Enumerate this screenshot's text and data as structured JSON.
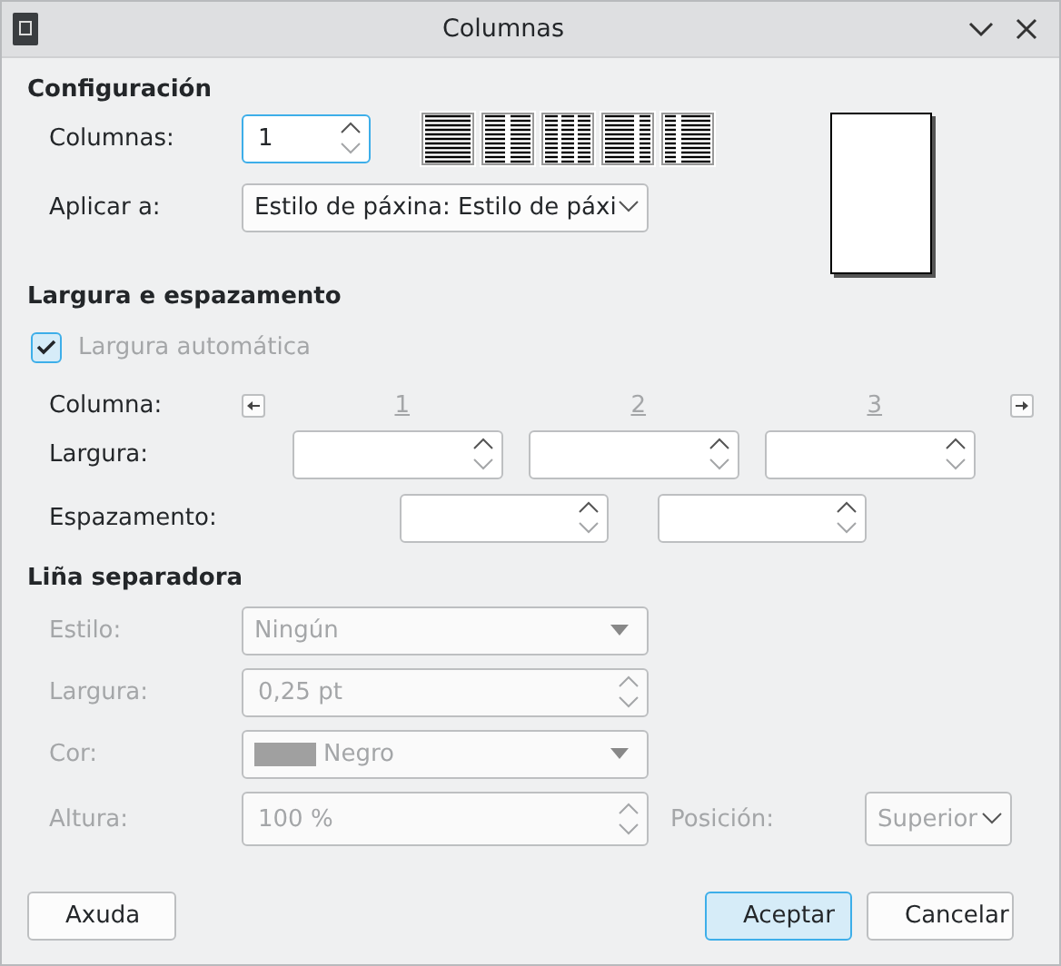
{
  "window": {
    "title": "Columnas"
  },
  "settings": {
    "heading": "Configuración",
    "columns_label": "Columnas:",
    "columns_value": "1",
    "columns_focused": true,
    "presets": [
      {
        "kind": "one",
        "selected": false
      },
      {
        "kind": "two",
        "selected": false
      },
      {
        "kind": "three",
        "selected": false
      },
      {
        "kind": "left",
        "selected": false
      },
      {
        "kind": "right",
        "selected": false
      }
    ],
    "apply_label": "Aplicar a:",
    "apply_value": "Estilo de páxina: Estilo de páxi"
  },
  "width_spacing": {
    "heading": "Largura e espazamento",
    "auto_width": {
      "label": "Largura automática",
      "checked": true,
      "disabled": true
    },
    "column_label": "Columna:",
    "column_numbers": [
      "1",
      "2",
      "3"
    ],
    "width_label": "Largura:",
    "width_fields": [
      {
        "kind": "spin"
      },
      {
        "kind": "spin"
      },
      {
        "kind": "spin"
      }
    ],
    "spacing_label": "Espazamento:",
    "spacing_fields": [
      {
        "kind": "spin"
      },
      {
        "kind": "spin"
      }
    ]
  },
  "separator": {
    "heading": "Liña separadora",
    "style": {
      "label": "Estilo:",
      "value": "Ningún",
      "disabled": true
    },
    "width": {
      "label": "Largura:",
      "value": "0,25 pt",
      "disabled": true
    },
    "color": {
      "label": "Cor:",
      "value": "Negro",
      "disabled": true
    },
    "height": {
      "label": "Altura:",
      "value": "100 %",
      "disabled": true
    },
    "position": {
      "label": "Posición:",
      "value": "Superior",
      "disabled": true
    }
  },
  "buttons": [
    {
      "label": "Axuda",
      "default": false
    },
    {
      "label": "Aceptar",
      "default": true
    },
    {
      "label": "Cancelar",
      "default": false
    }
  ]
}
